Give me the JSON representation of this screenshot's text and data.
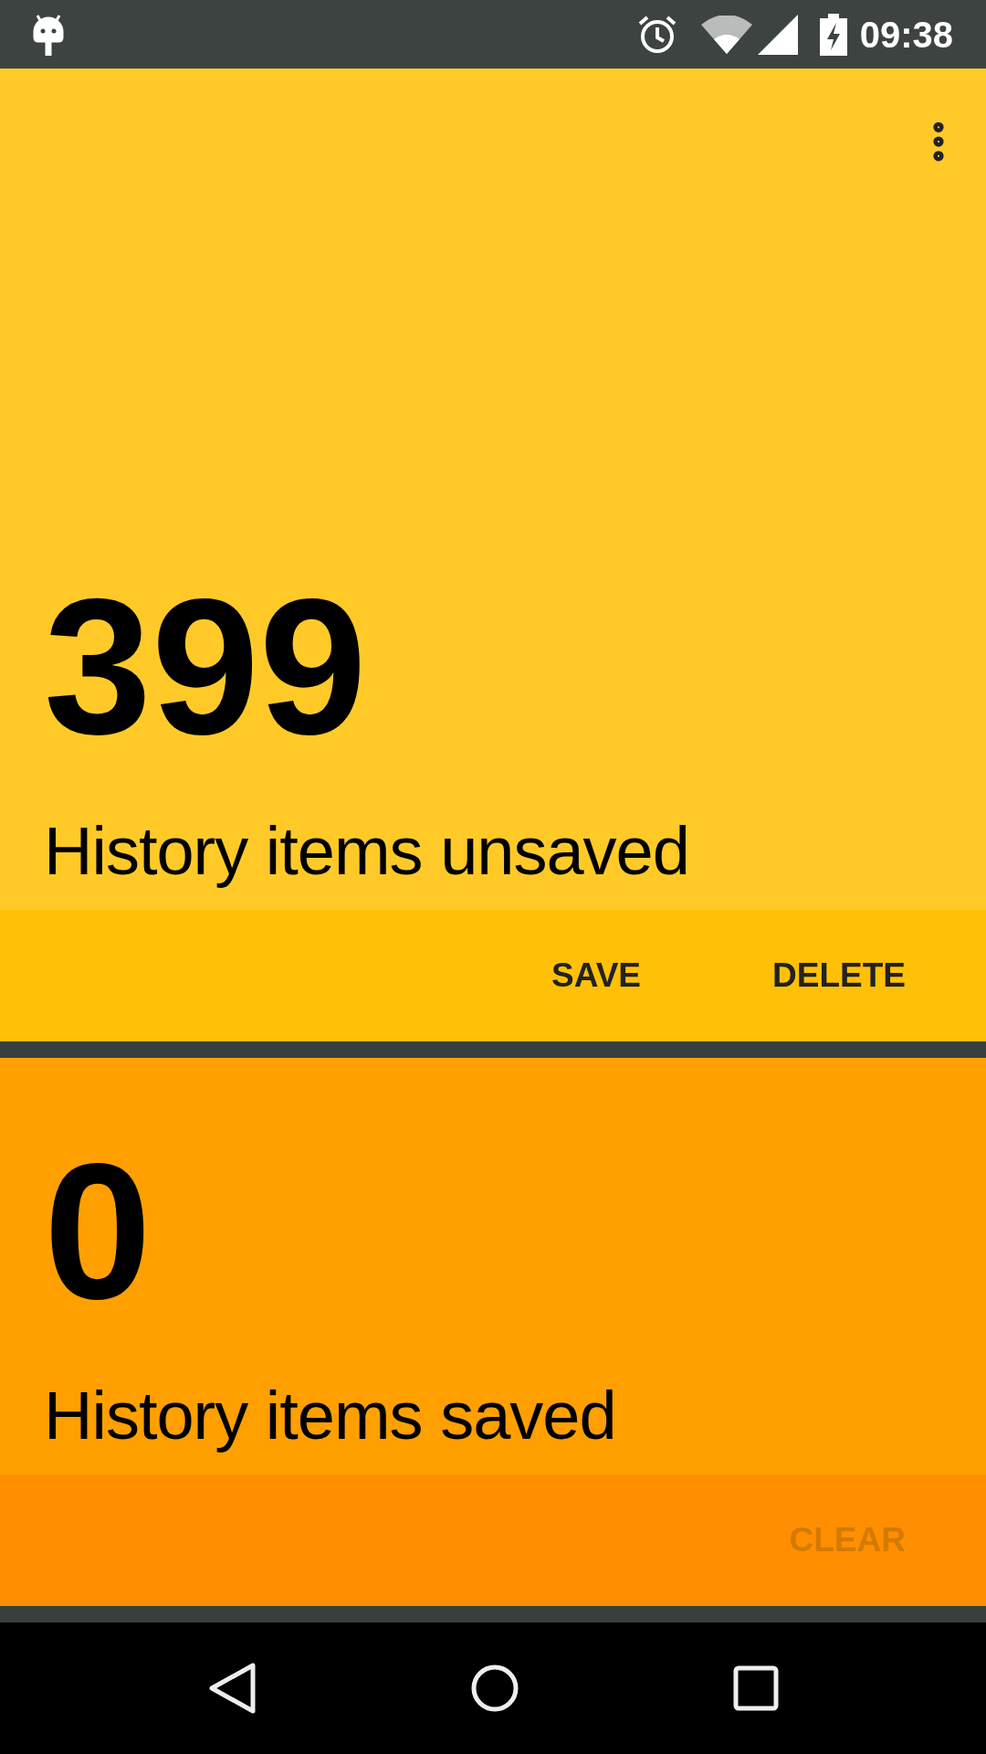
{
  "status_bar": {
    "time": "09:38"
  },
  "cards": [
    {
      "count": "399",
      "label": "History items unsaved",
      "kind": "unsaved",
      "actions": [
        {
          "label": "SAVE",
          "disabled": false
        },
        {
          "label": "DELETE",
          "disabled": false
        }
      ]
    },
    {
      "count": "0",
      "label": "History items saved",
      "kind": "saved",
      "actions": [
        {
          "label": "CLEAR",
          "disabled": true
        }
      ]
    }
  ]
}
